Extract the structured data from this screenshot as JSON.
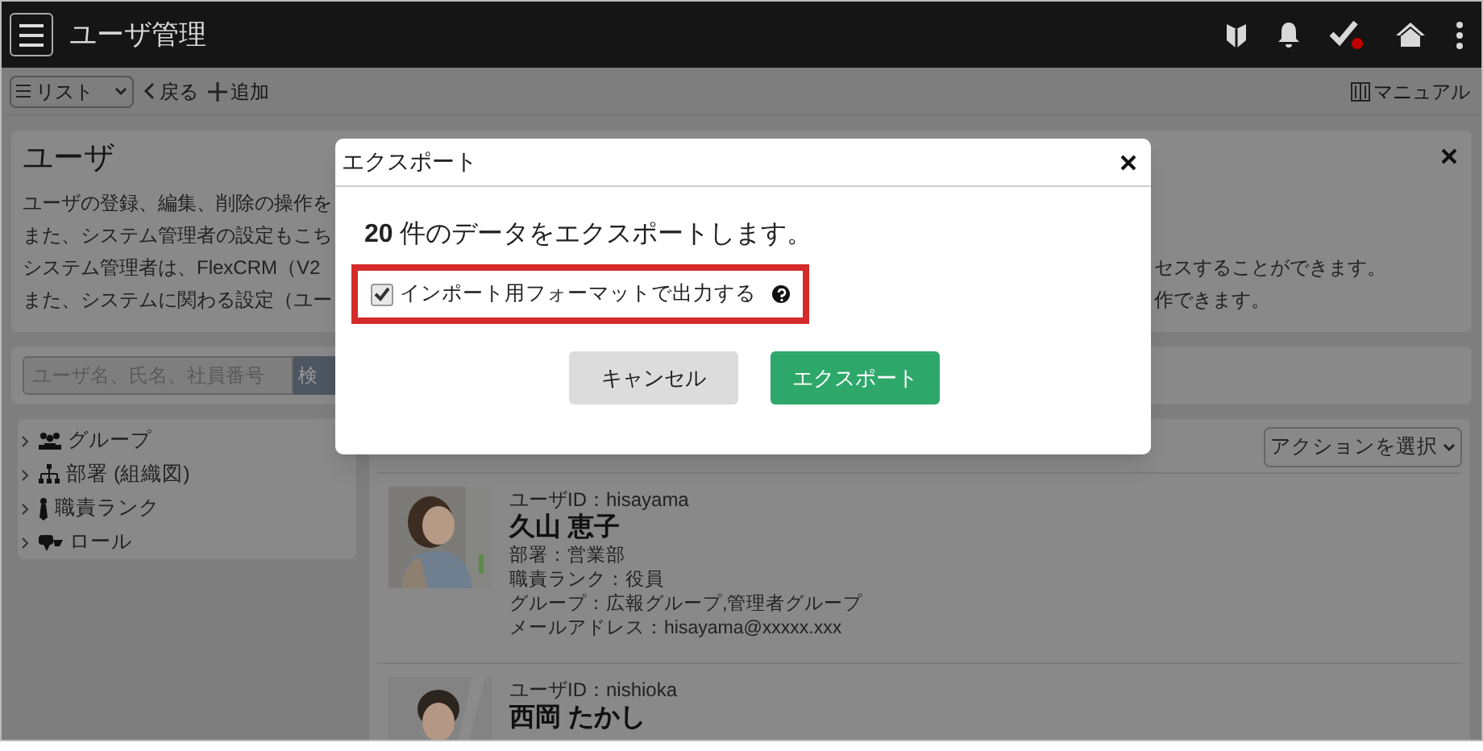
{
  "header": {
    "title": "ユーザ管理",
    "task_badge": true
  },
  "toolbar": {
    "view_select": "リスト",
    "back": "戻る",
    "add": "追加",
    "manual": "マニュアル"
  },
  "info_card": {
    "title": "ユーザ",
    "lines": [
      {
        "left": "ユーザの登録、編集、削除の操作を"
      },
      {
        "left": "また、システム管理者の設定もこち"
      },
      {
        "left": "システム管理者は、FlexCRM（V2",
        "right": "セスすることができます。"
      },
      {
        "left": "また、システムに関わる設定（ユー",
        "right": "作できます。"
      }
    ]
  },
  "search": {
    "placeholder": "ユーザ名、氏名、社員番号",
    "button": "検"
  },
  "tree": [
    {
      "kind": "group",
      "label": "グループ",
      "expanded": false
    },
    {
      "kind": "org",
      "label": "部署 (組織図)",
      "expanded": false
    },
    {
      "kind": "rank",
      "label": "職責ランク",
      "expanded": false
    },
    {
      "kind": "role",
      "label": "ロール",
      "expanded": false
    }
  ],
  "action_select": "アクションを選択",
  "users": [
    {
      "user_id": "ユーザID：hisayama",
      "name": "久山 恵子",
      "fields": [
        "部署：営業部",
        "職責ランク：役員",
        "グループ：広報グループ,管理者グループ",
        "メールアドレス：hisayama@xxxxx.xxx"
      ]
    },
    {
      "user_id": "ユーザID：nishioka",
      "name": "西岡 たかし"
    }
  ],
  "dialog": {
    "title": "エクスポート",
    "count": "20",
    "message": "件のデータをエクスポートします。",
    "import_format": {
      "label": "インポート用フォーマットで出力する",
      "checked": true,
      "highlighted": true
    },
    "buttons": [
      {
        "label": "キャンセル",
        "kind": "secondary"
      },
      {
        "label": "エクスポート",
        "kind": "primary"
      }
    ]
  }
}
